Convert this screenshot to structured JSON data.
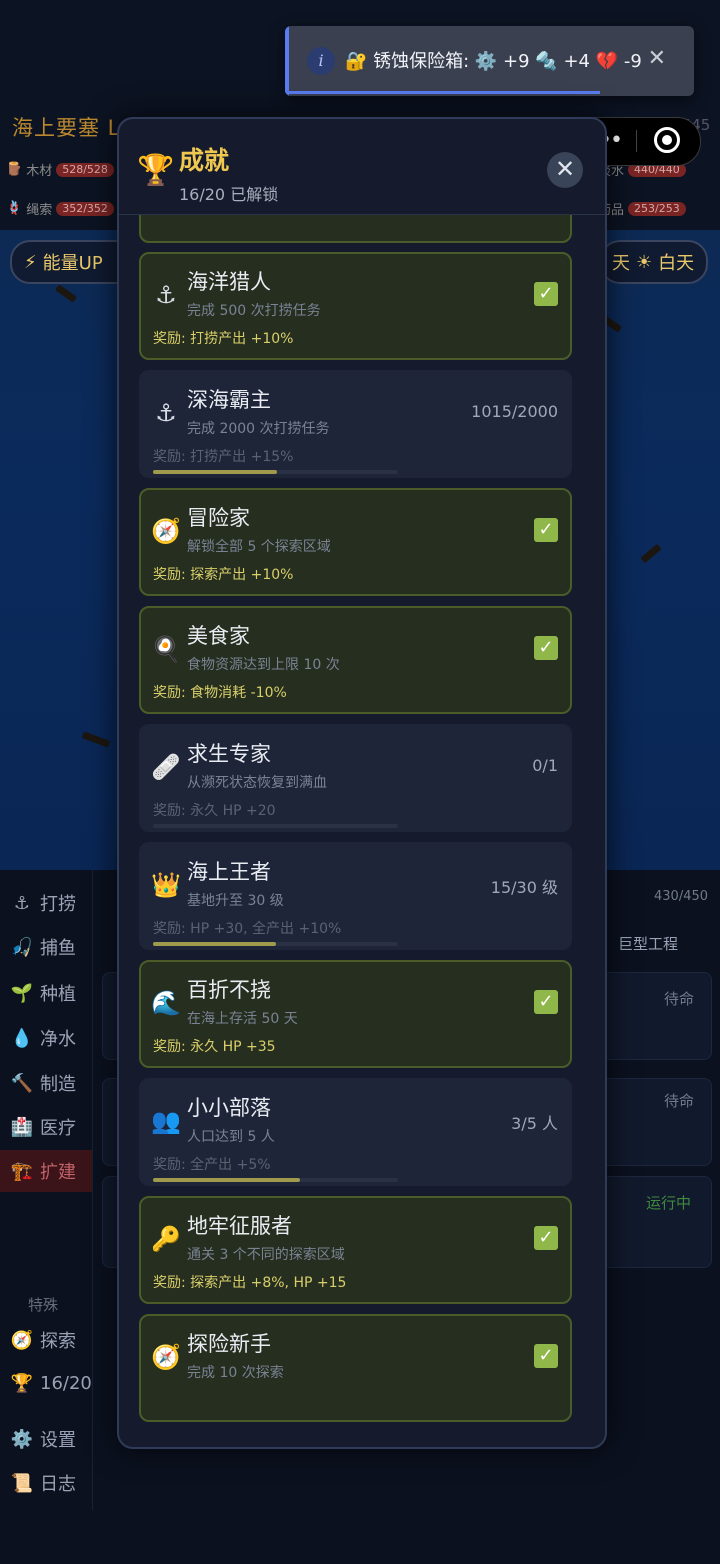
{
  "background": {
    "title": "海上要塞 Lv",
    "level_value": "408/445",
    "resources_left": [
      {
        "icon": "🪵",
        "name": "木材",
        "value": "528/528"
      },
      {
        "icon": "🪢",
        "name": "绳索",
        "value": "352/352"
      }
    ],
    "resources_right": [
      {
        "name": "淡水",
        "value": "440/440"
      },
      {
        "name": "药品",
        "value": "253/253"
      }
    ],
    "energy_pill": "能量UP",
    "day_pill": "天",
    "daytime_pill": "白天",
    "side_nav": [
      {
        "icon": "⚓",
        "label": "打捞"
      },
      {
        "icon": "🎣",
        "label": "捕鱼"
      },
      {
        "icon": "🌱",
        "label": "种植"
      },
      {
        "icon": "💧",
        "label": "净水"
      },
      {
        "icon": "🔨",
        "label": "制造"
      },
      {
        "icon": "🏥",
        "label": "医疗"
      },
      {
        "icon": "🏗️",
        "label": "扩建"
      }
    ],
    "side_special_header": "特殊",
    "side_special": [
      {
        "icon": "🧭",
        "label": "探索"
      },
      {
        "icon": "🏆",
        "label": "16/20"
      }
    ],
    "side_bottom": [
      {
        "icon": "⚙️",
        "label": "设置"
      },
      {
        "icon": "📜",
        "label": "日志"
      }
    ],
    "hp_text": "430/450",
    "right_tab": "巨型工程",
    "status_pending_1": "待命",
    "status_pending_2": "待命",
    "status_running": "运行中"
  },
  "toast": {
    "message": "🔐 锈蚀保险箱: ⚙️ +9 🔩 +4 💔 -9",
    "close": "✕",
    "progress": 0.77
  },
  "capsule": {
    "menu": "•••"
  },
  "modal": {
    "icon": "🏆",
    "title": "成就",
    "subtitle": "16/20 已解锁",
    "close": "✕",
    "achievements": [
      {
        "icon": "⚓",
        "name": "海洋猎人",
        "desc": "完成 500 次打捞任务",
        "reward": "奖励: 打捞产出 +10%",
        "done": true
      },
      {
        "icon": "⚓",
        "name": "深海霸主",
        "desc": "完成 2000 次打捞任务",
        "reward": "奖励: 打捞产出 +15%",
        "done": false,
        "progress": "1015/2000",
        "ratio": 0.5075
      },
      {
        "icon": "🧭",
        "name": "冒险家",
        "desc": "解锁全部 5 个探索区域",
        "reward": "奖励: 探索产出 +10%",
        "done": true
      },
      {
        "icon": "🍳",
        "name": "美食家",
        "desc": "食物资源达到上限 10 次",
        "reward": "奖励: 食物消耗 -10%",
        "done": true
      },
      {
        "icon": "🩹",
        "name": "求生专家",
        "desc": "从濒死状态恢复到满血",
        "reward": "奖励: 永久 HP +20",
        "done": false,
        "progress": "0/1",
        "ratio": 0
      },
      {
        "icon": "👑",
        "name": "海上王者",
        "desc": "基地升至 30 级",
        "reward": "奖励: HP +30, 全产出 +10%",
        "done": false,
        "progress": "15/30 级",
        "ratio": 0.5
      },
      {
        "icon": "🌊",
        "name": "百折不挠",
        "desc": "在海上存活 50 天",
        "reward": "奖励: 永久 HP +35",
        "done": true
      },
      {
        "icon": "👥",
        "name": "小小部落",
        "desc": "人口达到 5 人",
        "reward": "奖励: 全产出 +5%",
        "done": false,
        "progress": "3/5 人",
        "ratio": 0.6
      },
      {
        "icon": "🔑",
        "name": "地牢征服者",
        "desc": "通关 3 个不同的探索区域",
        "reward": "奖励: 探索产出 +8%, HP +15",
        "done": true
      },
      {
        "icon": "🧭",
        "name": "探险新手",
        "desc": "完成 10 次探索",
        "reward": "",
        "done": true
      }
    ]
  },
  "colors": {
    "accent_gold": "#f0c850",
    "done_border": "#4c5c28",
    "check_green": "#8fb74a",
    "toast_accent": "#5a7cf0"
  }
}
